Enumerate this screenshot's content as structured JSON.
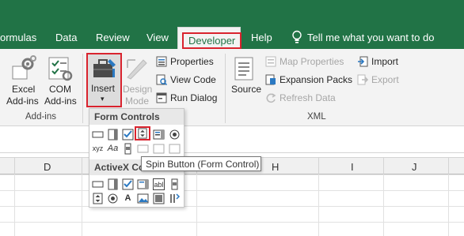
{
  "tabs": [
    "ormulas",
    "Data",
    "Review",
    "View",
    "Developer",
    "Help"
  ],
  "tell_me": "Tell me what you want to do",
  "ribbon": {
    "excel_addins": [
      "Excel",
      "Add-ins"
    ],
    "com_addins": [
      "COM",
      "Add-ins"
    ],
    "addins_group": "Add-ins",
    "insert": "Insert",
    "design_mode": [
      "Design",
      "Mode"
    ],
    "properties": "Properties",
    "view_code": "View Code",
    "run_dialog": "Run Dialog",
    "source": "Source",
    "map_properties": "Map Properties",
    "expansion_packs": "Expansion Packs",
    "refresh_data": "Refresh Data",
    "import": "Import",
    "export": "Export",
    "xml_group": "XML"
  },
  "dropdown": {
    "form_controls": "Form Controls",
    "activex_controls": "ActiveX Co"
  },
  "columns": [
    "D",
    "H",
    "I",
    "J"
  ],
  "tooltip": "Spin Button (Form Control)",
  "colors": {
    "ribbon_green": "#217346",
    "highlight_red": "#d9232e"
  }
}
